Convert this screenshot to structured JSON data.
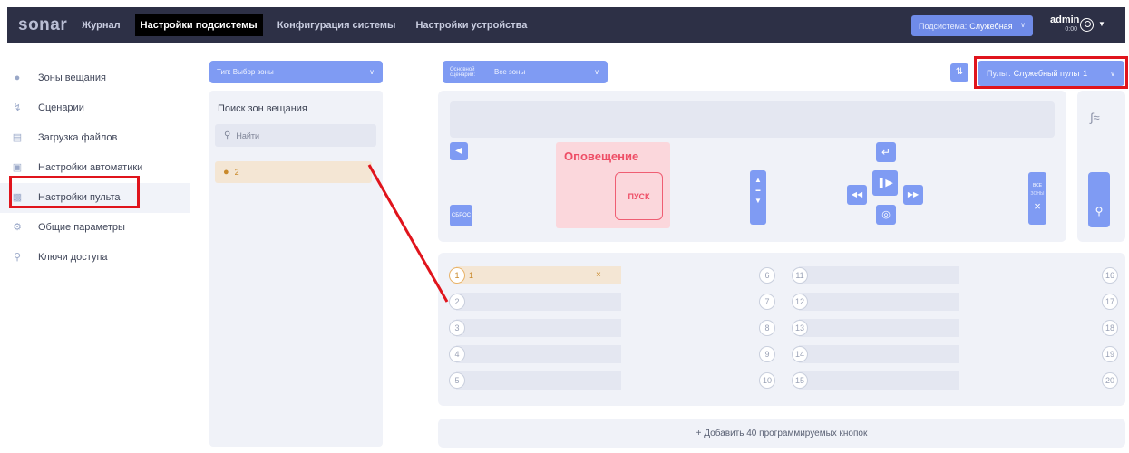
{
  "header": {
    "logo": "sonar",
    "nav": [
      "Журнал",
      "Настройки подсистемы",
      "Конфигурация системы",
      "Настройки устройства"
    ],
    "subsystem_key": "Подсистема:",
    "subsystem_value": "Служебная",
    "user": "admin",
    "user_sub": "0:00"
  },
  "sidebar": {
    "items": [
      {
        "label": "Зоны вещания",
        "icon": "mic-icon"
      },
      {
        "label": "Сценарии",
        "icon": "scenario-icon"
      },
      {
        "label": "Загрузка файлов",
        "icon": "file-icon"
      },
      {
        "label": "Настройки автоматики",
        "icon": "automation-icon"
      },
      {
        "label": "Настройки пульта",
        "icon": "console-icon"
      },
      {
        "label": "Общие параметры",
        "icon": "gears-icon"
      },
      {
        "label": "Ключи доступа",
        "icon": "key-icon"
      }
    ]
  },
  "filters": {
    "type_label": "Тип:",
    "type_value": "Выбор зоны",
    "scenario_key": "Основной сценарий:",
    "scenario_value": "Все зоны",
    "pult_key": "Пульт:",
    "pult_value": "Служебный пульт 1"
  },
  "search": {
    "title": "Поиск зон вещания",
    "placeholder": "Найти",
    "selected_zone": "2"
  },
  "controls": {
    "alert_title": "Оповещение",
    "start": "ПУСК",
    "reset": "СБРОС",
    "all_top": "ВСЕ",
    "all_bottom": "ЗОНЫ"
  },
  "zones": {
    "columns": [
      [
        1,
        2,
        3,
        4,
        5
      ],
      [
        6,
        7,
        8,
        9,
        10
      ],
      [
        11,
        12,
        13,
        14,
        15
      ],
      [
        16,
        17,
        18,
        19,
        20
      ]
    ],
    "selected": 1,
    "selected_label": "1"
  },
  "add_button": "+ Добавить 40 программируемых кнопок",
  "colors": {
    "accent": "#7f9bf3",
    "topbar": "#2d3046",
    "alert": "#ee4e66",
    "highlight": "#e0141c"
  }
}
